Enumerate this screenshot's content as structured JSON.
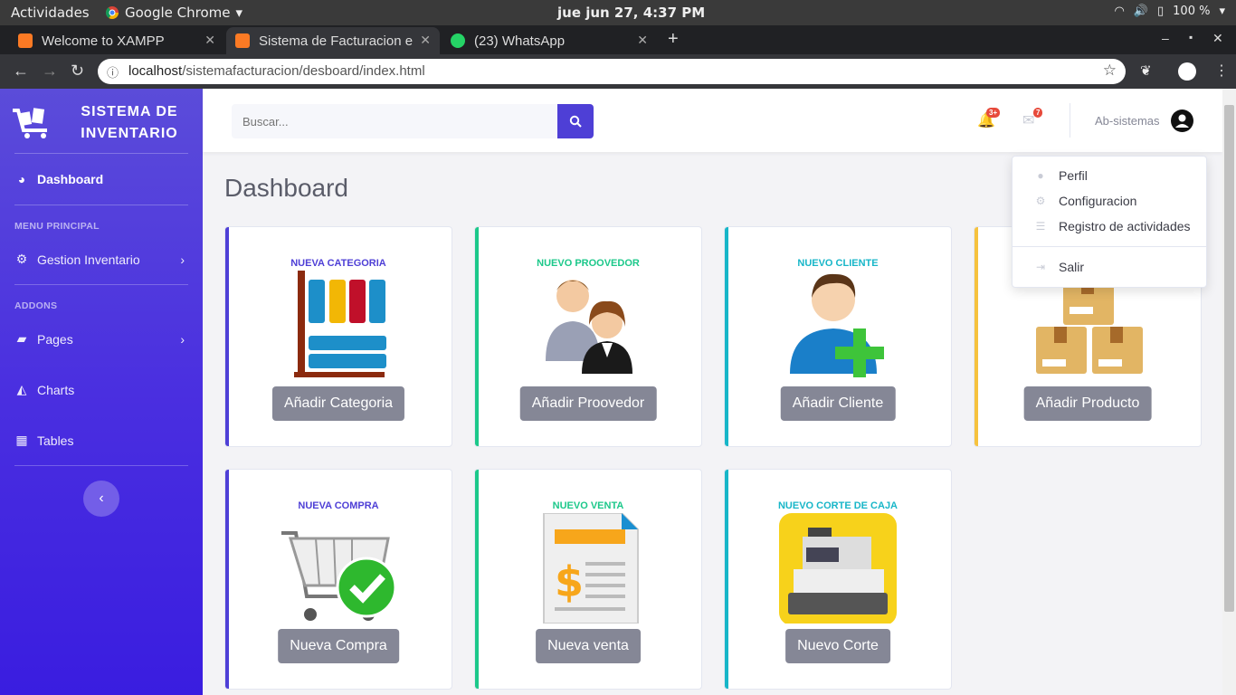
{
  "os": {
    "activities": "Actividades",
    "app": "Google Chrome",
    "clock": "jue jun 27,  4:37 PM",
    "battery": "100 %"
  },
  "tabs": [
    {
      "label": "Welcome to XAMPP"
    },
    {
      "label": "Sistema de Facturacion e"
    },
    {
      "label": "(23) WhatsApp"
    }
  ],
  "address": {
    "host": "localhost",
    "path": "/sistemafacturacion/desboard/index.html"
  },
  "sidebar": {
    "brand": "SISTEMA DE INVENTARIO",
    "dashboard": "Dashboard",
    "menu_heading": "MENU PRINCIPAL",
    "gestion": "Gestion Inventario",
    "addons_heading": "ADDONS",
    "pages": "Pages",
    "charts": "Charts",
    "tables": "Tables"
  },
  "topbar": {
    "search_placeholder": "Buscar...",
    "alerts_count": "3+",
    "messages_count": "7",
    "user_name": "Ab-sistemas"
  },
  "page_title": "Dashboard",
  "cards": [
    {
      "title": "NUEVA CATEGORIA",
      "button": "Añadir Categoria",
      "color": "#4e3fd6"
    },
    {
      "title": "NUEVO PROOVEDOR",
      "button": "Añadir Proovedor",
      "color": "#1cc88a"
    },
    {
      "title": "NUEVO CLIENTE",
      "button": "Añadir Cliente",
      "color": "#17b6c8"
    },
    {
      "title": "",
      "button": "Añadir Producto",
      "color": "#f6c23e"
    },
    {
      "title": "NUEVA COMPRA",
      "button": "Nueva Compra",
      "color": "#4e3fd6"
    },
    {
      "title": "NUEVO VENTA",
      "button": "Nueva venta",
      "color": "#1cc88a"
    },
    {
      "title": "NUEVO CORTE DE CAJA",
      "button": "Nuevo Corte",
      "color": "#17b6c8"
    }
  ],
  "dropdown": {
    "perfil": "Perfil",
    "config": "Configuracion",
    "registro": "Registro de actividades",
    "salir": "Salir"
  }
}
